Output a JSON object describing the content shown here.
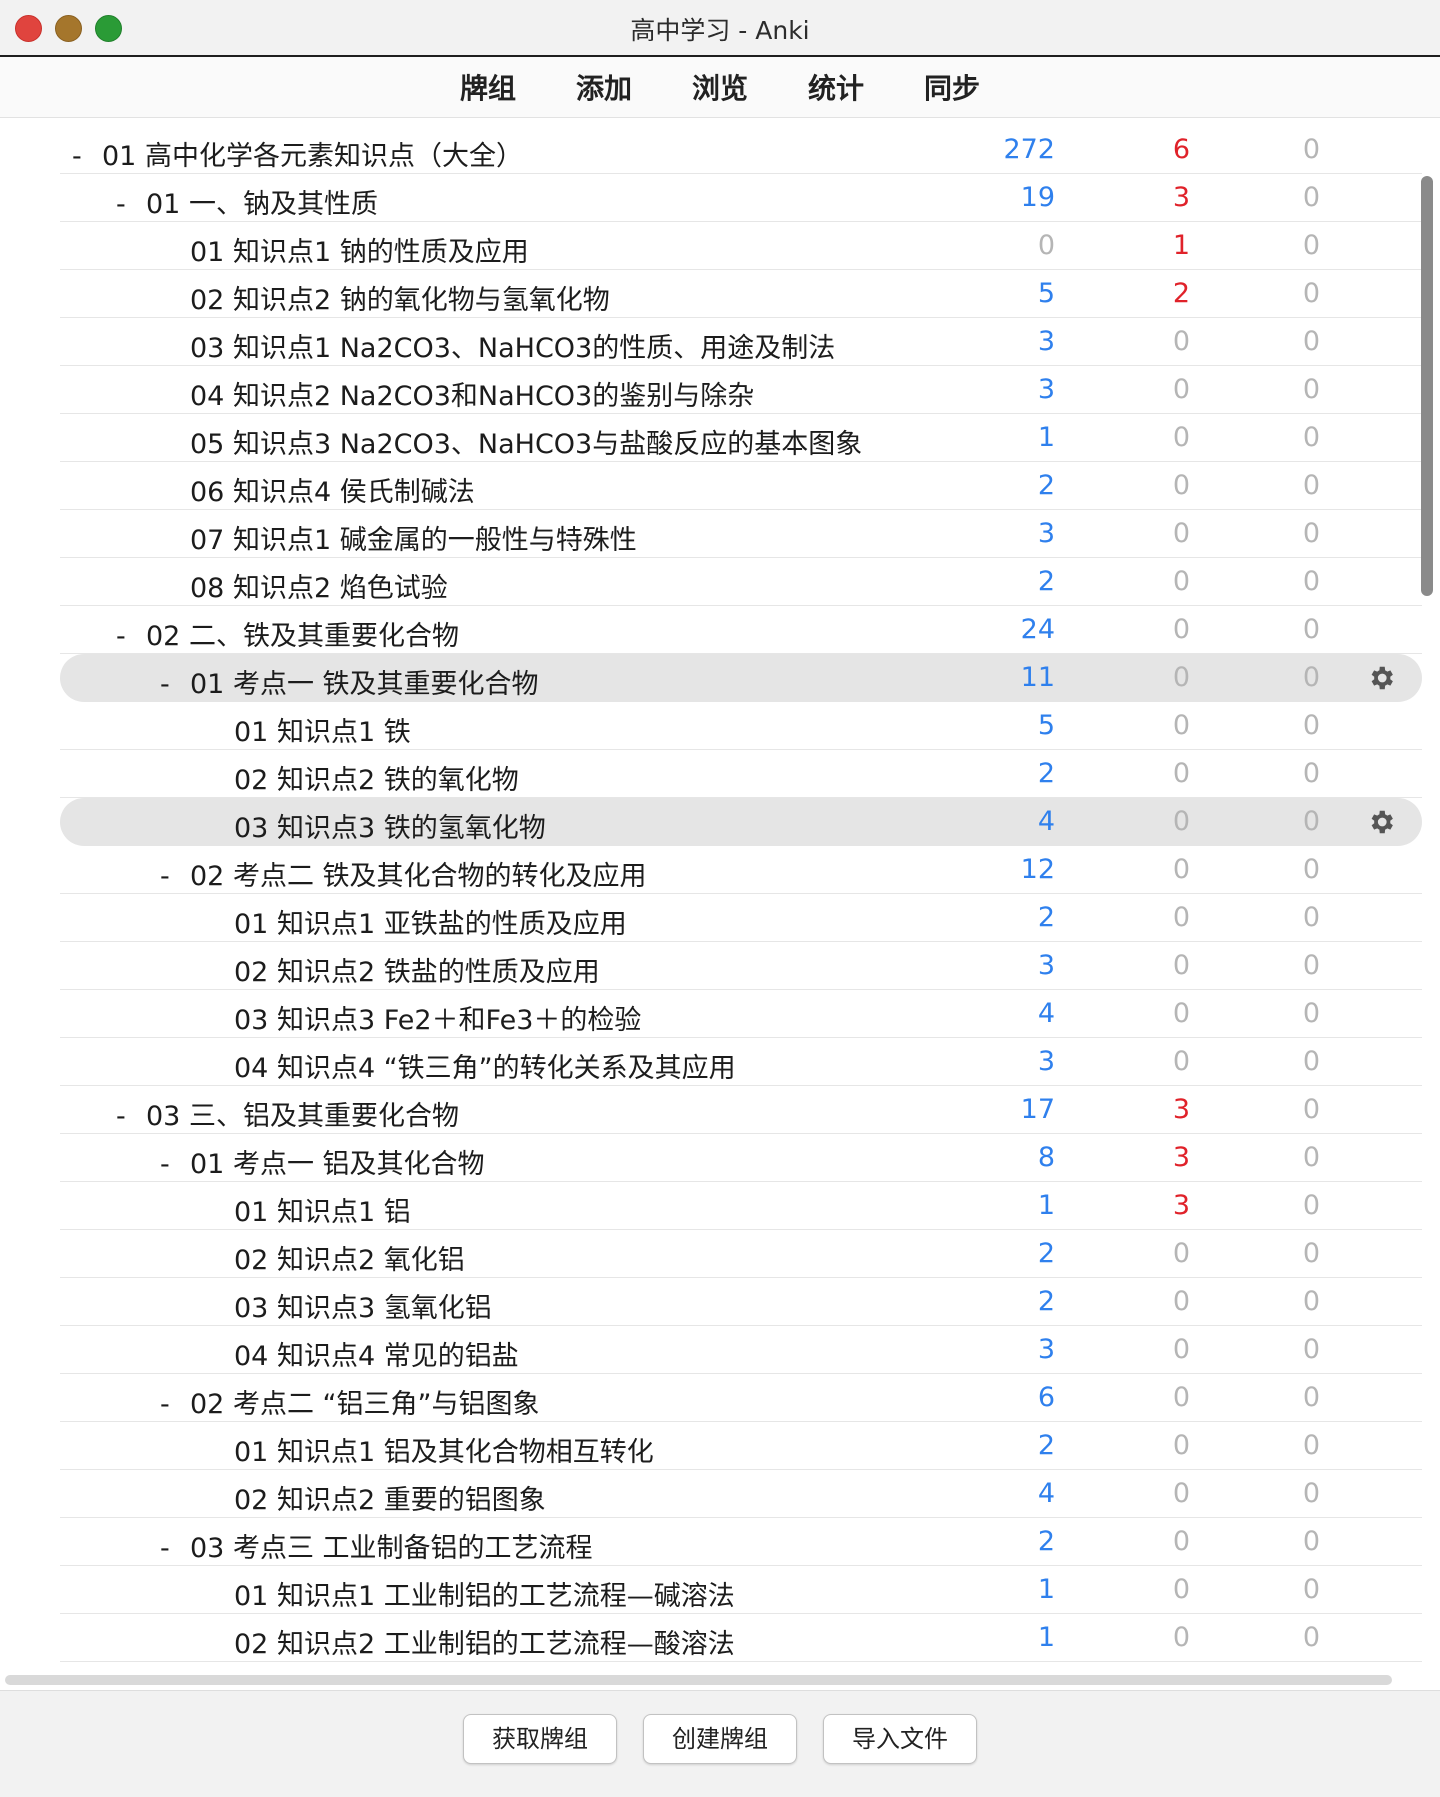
{
  "window": {
    "title": "高中学习 - Anki"
  },
  "toolbar": {
    "items": [
      "牌组",
      "添加",
      "浏览",
      "统计",
      "同步"
    ]
  },
  "collapse_symbol": "-",
  "colors": {
    "new": "#2f80ed",
    "learn": "#e0222a",
    "zero": "#b5b5b5"
  },
  "decks": [
    {
      "name": "01 高中化学各元素知识点（大全）",
      "indent": 0,
      "collapse": true,
      "new": "272",
      "learn": "6",
      "due": "0"
    },
    {
      "name": "01 一、钠及其性质",
      "indent": 1,
      "collapse": true,
      "new": "19",
      "learn": "3",
      "due": "0"
    },
    {
      "name": "01 知识点1 钠的性质及应用",
      "indent": 2,
      "collapse": false,
      "new": "0",
      "learn": "1",
      "due": "0"
    },
    {
      "name": "02 知识点2 钠的氧化物与氢氧化物",
      "indent": 2,
      "collapse": false,
      "new": "5",
      "learn": "2",
      "due": "0"
    },
    {
      "name": "03 知识点1 Na2CO3、NaHCO3的性质、用途及制法",
      "indent": 2,
      "collapse": false,
      "new": "3",
      "learn": "0",
      "due": "0"
    },
    {
      "name": "04 知识点2 Na2CO3和NaHCO3的鉴别与除杂",
      "indent": 2,
      "collapse": false,
      "new": "3",
      "learn": "0",
      "due": "0"
    },
    {
      "name": "05 知识点3 Na2CO3、NaHCO3与盐酸反应的基本图象",
      "indent": 2,
      "collapse": false,
      "new": "1",
      "learn": "0",
      "due": "0"
    },
    {
      "name": "06 知识点4 侯氏制碱法",
      "indent": 2,
      "collapse": false,
      "new": "2",
      "learn": "0",
      "due": "0"
    },
    {
      "name": "07 知识点1 碱金属的一般性与特殊性",
      "indent": 2,
      "collapse": false,
      "new": "3",
      "learn": "0",
      "due": "0"
    },
    {
      "name": "08 知识点2 焰色试验",
      "indent": 2,
      "collapse": false,
      "new": "2",
      "learn": "0",
      "due": "0"
    },
    {
      "name": "02 二、铁及其重要化合物",
      "indent": 1,
      "collapse": true,
      "new": "24",
      "learn": "0",
      "due": "0"
    },
    {
      "name": "01 考点一 铁及其重要化合物",
      "indent": 2,
      "collapse": true,
      "new": "11",
      "learn": "0",
      "due": "0",
      "highlight": true
    },
    {
      "name": "01 知识点1 铁",
      "indent": 3,
      "collapse": false,
      "new": "5",
      "learn": "0",
      "due": "0"
    },
    {
      "name": "02 知识点2 铁的氧化物",
      "indent": 3,
      "collapse": false,
      "new": "2",
      "learn": "0",
      "due": "0"
    },
    {
      "name": "03 知识点3 铁的氢氧化物",
      "indent": 3,
      "collapse": false,
      "new": "4",
      "learn": "0",
      "due": "0",
      "highlight": true
    },
    {
      "name": "02 考点二 铁及其化合物的转化及应用",
      "indent": 2,
      "collapse": true,
      "new": "12",
      "learn": "0",
      "due": "0"
    },
    {
      "name": "01 知识点1 亚铁盐的性质及应用",
      "indent": 3,
      "collapse": false,
      "new": "2",
      "learn": "0",
      "due": "0"
    },
    {
      "name": "02 知识点2 铁盐的性质及应用",
      "indent": 3,
      "collapse": false,
      "new": "3",
      "learn": "0",
      "due": "0"
    },
    {
      "name": "03 知识点3 Fe2＋和Fe3＋的检验",
      "indent": 3,
      "collapse": false,
      "new": "4",
      "learn": "0",
      "due": "0"
    },
    {
      "name": "04 知识点4 “铁三角”的转化关系及其应用",
      "indent": 3,
      "collapse": false,
      "new": "3",
      "learn": "0",
      "due": "0"
    },
    {
      "name": "03 三、铝及其重要化合物",
      "indent": 1,
      "collapse": true,
      "new": "17",
      "learn": "3",
      "due": "0"
    },
    {
      "name": "01 考点一 铝及其化合物",
      "indent": 2,
      "collapse": true,
      "new": "8",
      "learn": "3",
      "due": "0"
    },
    {
      "name": "01 知识点1 铝",
      "indent": 3,
      "collapse": false,
      "new": "1",
      "learn": "3",
      "due": "0"
    },
    {
      "name": "02 知识点2 氧化铝",
      "indent": 3,
      "collapse": false,
      "new": "2",
      "learn": "0",
      "due": "0"
    },
    {
      "name": "03 知识点3 氢氧化铝",
      "indent": 3,
      "collapse": false,
      "new": "2",
      "learn": "0",
      "due": "0"
    },
    {
      "name": "04 知识点4 常见的铝盐",
      "indent": 3,
      "collapse": false,
      "new": "3",
      "learn": "0",
      "due": "0"
    },
    {
      "name": "02 考点二 “铝三角”与铝图象",
      "indent": 2,
      "collapse": true,
      "new": "6",
      "learn": "0",
      "due": "0"
    },
    {
      "name": "01 知识点1 铝及其化合物相互转化",
      "indent": 3,
      "collapse": false,
      "new": "2",
      "learn": "0",
      "due": "0"
    },
    {
      "name": "02 知识点2 重要的铝图象",
      "indent": 3,
      "collapse": false,
      "new": "4",
      "learn": "0",
      "due": "0"
    },
    {
      "name": "03 考点三 工业制备铝的工艺流程",
      "indent": 2,
      "collapse": true,
      "new": "2",
      "learn": "0",
      "due": "0"
    },
    {
      "name": "01 知识点1 工业制铝的工艺流程—碱溶法",
      "indent": 3,
      "collapse": false,
      "new": "1",
      "learn": "0",
      "due": "0"
    },
    {
      "name": "02 知识点2 工业制铝的工艺流程—酸溶法",
      "indent": 3,
      "collapse": false,
      "new": "1",
      "learn": "0",
      "due": "0"
    }
  ],
  "bottom": {
    "buttons": [
      "获取牌组",
      "创建牌组",
      "导入文件"
    ]
  }
}
